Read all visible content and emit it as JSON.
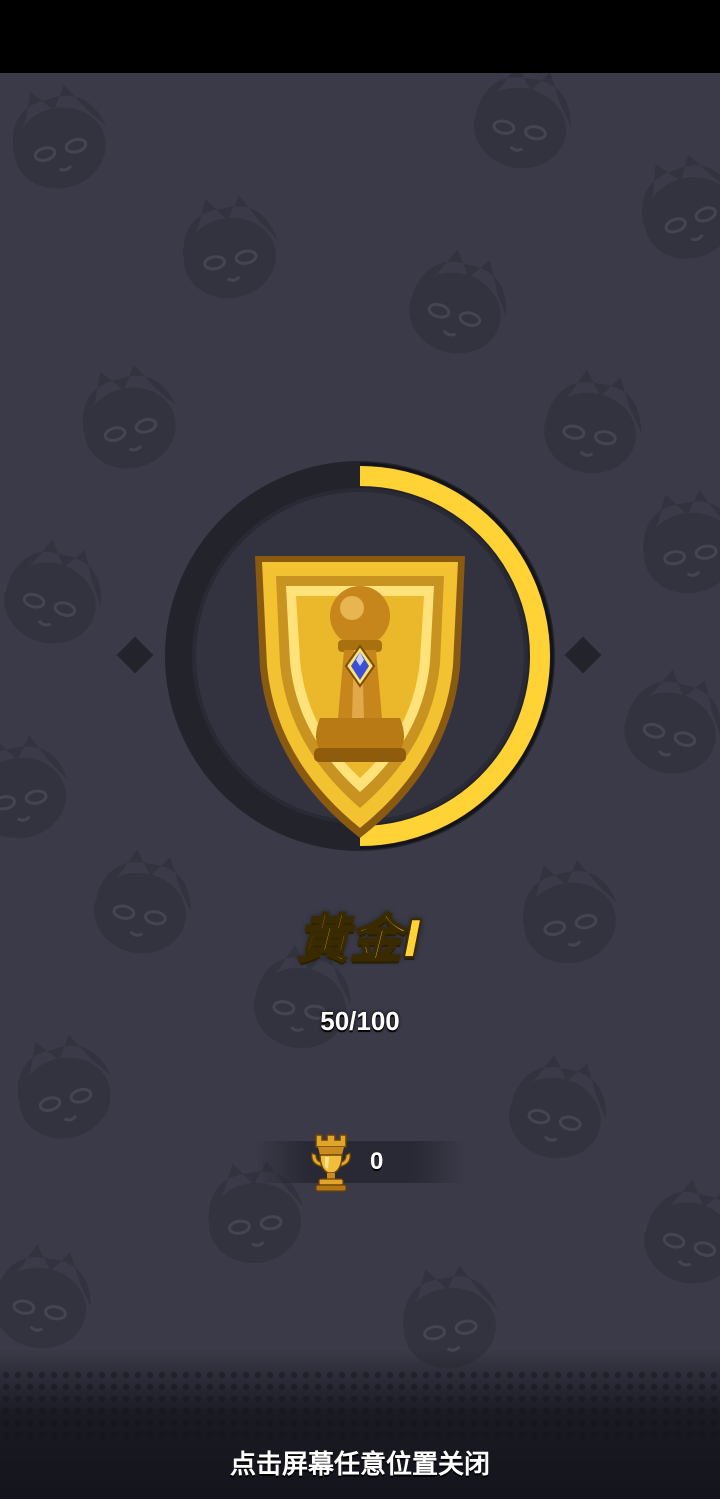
{
  "rank": {
    "name": "黄金I",
    "tier_icon": "gold-shield-pawn-icon",
    "progress_text": "50/100",
    "progress_value": 50,
    "progress_max": 100
  },
  "trophy": {
    "icon": "trophy-rook-icon",
    "count": "0"
  },
  "footer": {
    "close_hint": "点击屏幕任意位置关闭"
  },
  "colors": {
    "background": "#3a3a48",
    "ring_dark": "#23232c",
    "ring_progress": "#ffd335",
    "gold": "#e8b522",
    "gold_light": "#ffe27a",
    "gold_dark": "#8a5a10"
  }
}
